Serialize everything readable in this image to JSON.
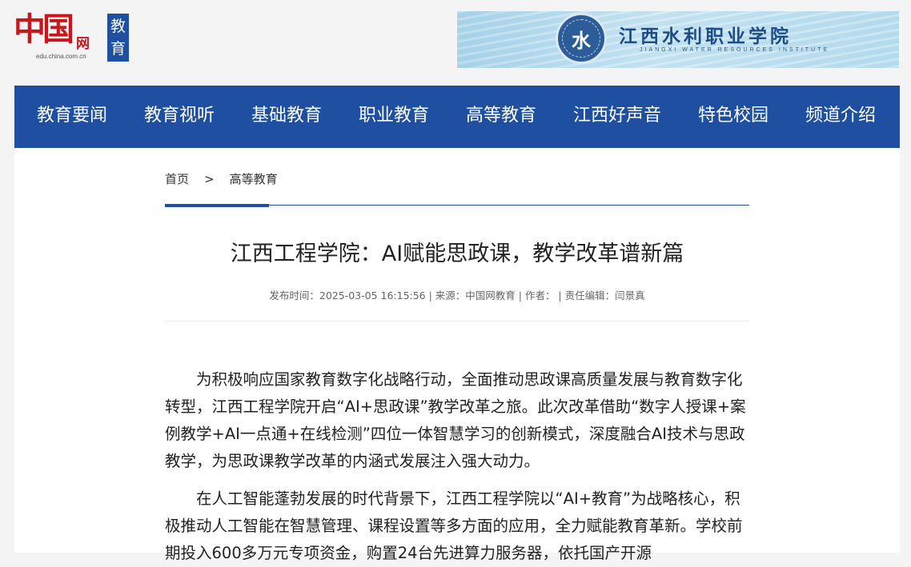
{
  "header": {
    "logo": {
      "chars": "中国",
      "wang": "网",
      "domain": "edu.china.com.cn",
      "badge": "教育"
    },
    "banner": {
      "emblem_glyph": "水",
      "name_cn": "江西水利职业学院",
      "name_en": "JIANGXI WATER RESOURCES INSTITUTE"
    }
  },
  "nav": {
    "items": [
      "教育要闻",
      "教育视听",
      "基础教育",
      "职业教育",
      "高等教育",
      "江西好声音",
      "特色校园",
      "频道介绍"
    ]
  },
  "breadcrumb": {
    "home": "首页",
    "separator": ">",
    "current": "高等教育"
  },
  "article": {
    "title": "江西工程学院：AI赋能思政课，教学改革谱新篇",
    "meta": "发布时间：2025-03-05 16:15:56 | 来源：中国网教育 | 作者： | 责任编辑：闫景真",
    "paragraphs": [
      "为积极响应国家教育数字化战略行动，全面推动思政课高质量发展与教育数字化转型，江西工程学院开启“AI+思政课”教学改革之旅。此次改革借助“数字人授课+案例教学+AI一点通+在线检测”四位一体智慧学习的创新模式，深度融合AI技术与思政教学，为思政课教学改革的内涵式发展注入强大动力。",
      "在人工智能蓬勃发展的时代背景下，江西工程学院以“AI+教育”为战略核心，积极推动人工智能在智慧管理、课程设置等多方面的应用，全力赋能教育革新。学校前期投入600多万元专项资金，购置24台先进算力服务器，依托国产开源"
    ]
  },
  "colors": {
    "brand_blue": "#1e4fa0",
    "logo_red": "#c8161d",
    "page_bg": "#f4f4f4"
  }
}
